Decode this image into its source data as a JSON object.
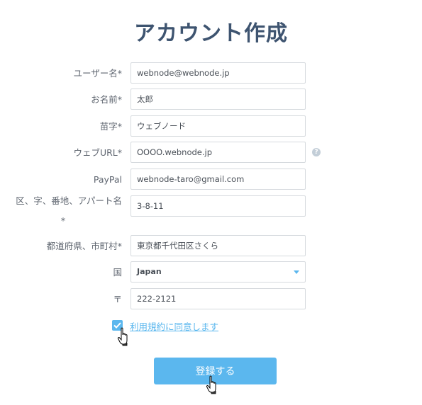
{
  "page": {
    "title": "アカウント作成"
  },
  "form": {
    "username": {
      "label": "ユーザー名*",
      "value": "webnode@webnode.jp"
    },
    "first_name": {
      "label": "お名前*",
      "value": "太郎"
    },
    "last_name": {
      "label": "苗字*",
      "value": "ウェブノード"
    },
    "web_url": {
      "label": "ウェブURL*",
      "value": "OOOO.webnode.jp",
      "help_icon": "?"
    },
    "paypal": {
      "label": "PayPal",
      "value": "webnode-taro@gmail.com"
    },
    "address": {
      "label": "区、字、番地、アパート名",
      "label_star": "*",
      "value": "3-8-11"
    },
    "city": {
      "label": "都道府県、市町村*",
      "value": "東京都千代田区さくら"
    },
    "country": {
      "label": "国",
      "value": "Japan"
    },
    "zip": {
      "label": "〒",
      "value": "222-2121"
    }
  },
  "terms": {
    "checked": true,
    "label": "利用規約に同意します"
  },
  "submit": {
    "label": "登録する"
  },
  "colors": {
    "accent": "#5bb7ee",
    "title": "#3e5470",
    "border": "#d6dade"
  }
}
